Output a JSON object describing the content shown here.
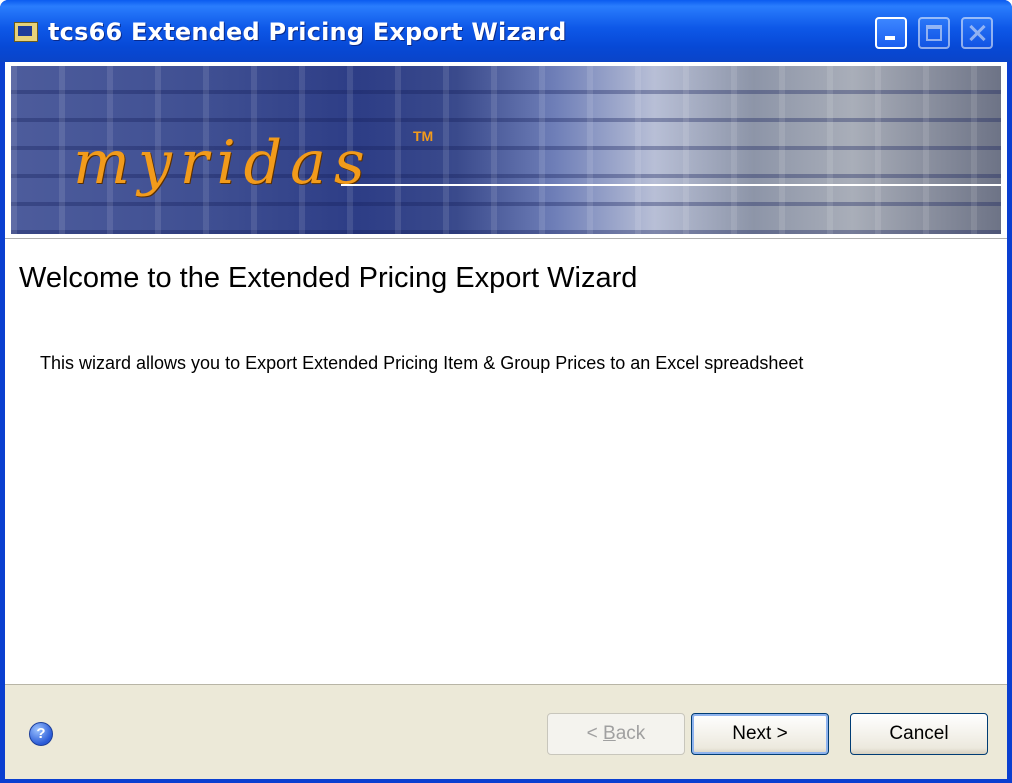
{
  "window": {
    "title": "tcs66 Extended Pricing Export Wizard"
  },
  "banner": {
    "logo_text": "myridas",
    "trademark": "TM"
  },
  "main": {
    "heading": "Welcome to the Extended Pricing Export Wizard",
    "description": "This wizard allows you to Export Extended Pricing Item & Group Prices to an Excel spreadsheet"
  },
  "footer": {
    "help_icon": "help-icon",
    "back_label_pre": "< ",
    "back_label_accel": "B",
    "back_label_post": "ack",
    "next_label": "Next >",
    "cancel_label": "Cancel"
  },
  "colors": {
    "titlebar": "#0a4fe0",
    "dialog_background": "#ffffff",
    "footer_background": "#ece9d8",
    "logo": "#f29b1b"
  }
}
